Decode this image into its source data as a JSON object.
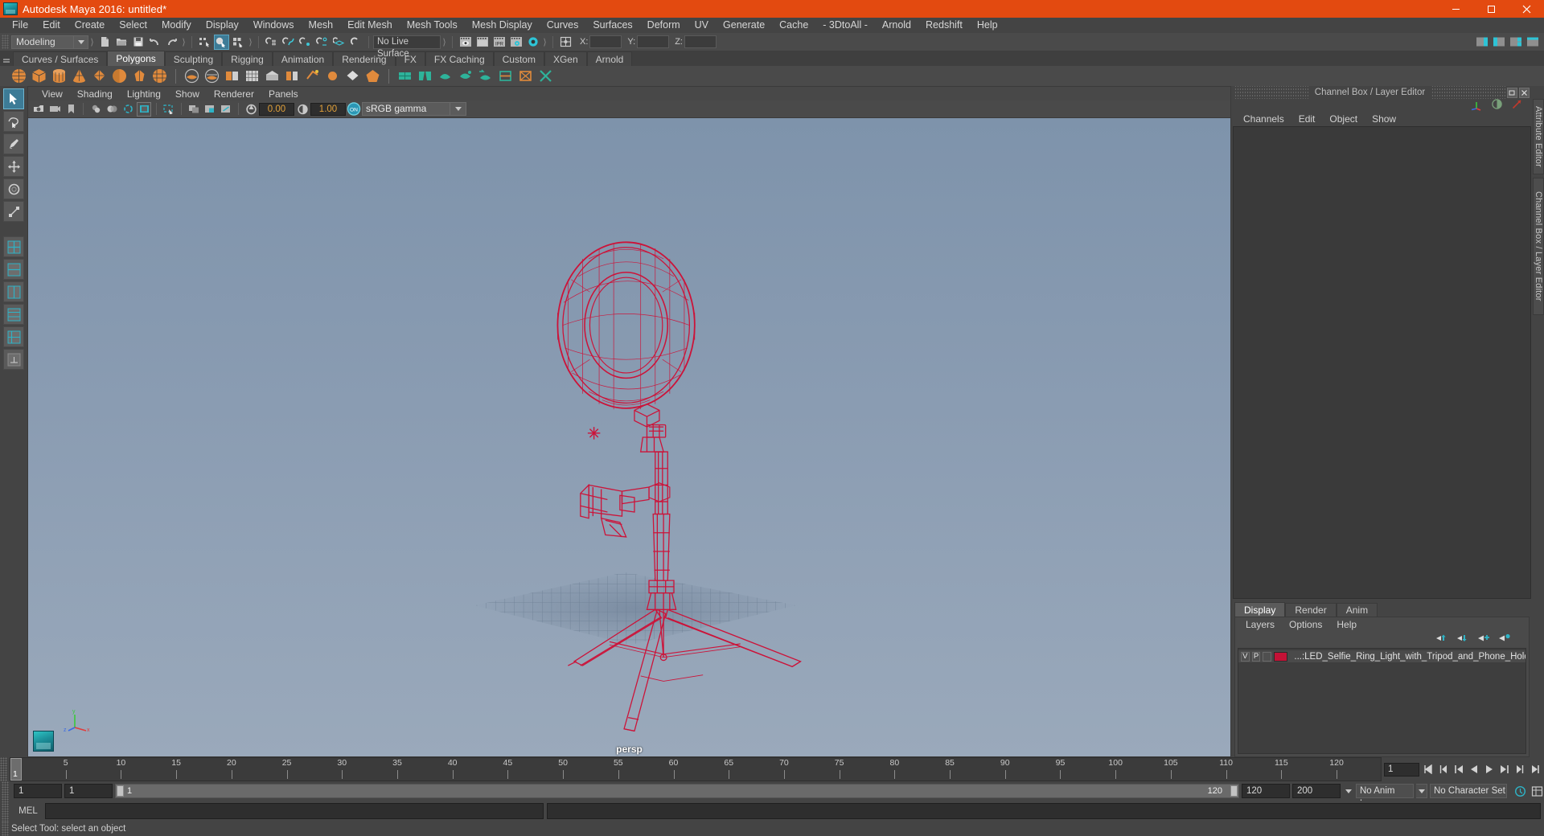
{
  "titlebar": {
    "title": "Autodesk Maya 2016: untitled*",
    "logo_icon": "maya-logo-icon",
    "minimize_icon": "minimize-icon",
    "maximize_icon": "maximize-icon",
    "close_icon": "close-icon"
  },
  "menubar": {
    "items": [
      {
        "label": "File"
      },
      {
        "label": "Edit"
      },
      {
        "label": "Create"
      },
      {
        "label": "Select"
      },
      {
        "label": "Modify"
      },
      {
        "label": "Display"
      },
      {
        "label": "Windows"
      },
      {
        "label": "Mesh"
      },
      {
        "label": "Edit Mesh"
      },
      {
        "label": "Mesh Tools"
      },
      {
        "label": "Mesh Display"
      },
      {
        "label": "Curves"
      },
      {
        "label": "Surfaces"
      },
      {
        "label": "Deform"
      },
      {
        "label": "UV"
      },
      {
        "label": "Generate"
      },
      {
        "label": "Cache"
      },
      {
        "label": "- 3DtoAll -"
      },
      {
        "label": "Arnold"
      },
      {
        "label": "Redshift"
      },
      {
        "label": "Help"
      }
    ]
  },
  "statusbar": {
    "menu_set": "Modeling",
    "menu_set_arrow_icon": "chevron-down-icon",
    "file_icons": [
      "new-scene-icon",
      "open-scene-icon",
      "save-scene-icon",
      "undo-icon",
      "redo-icon"
    ],
    "select_mode_icons": [
      "select-hierarchy-icon",
      "select-object-icon",
      "select-component-icon"
    ],
    "snap_icons": [
      "snap-grid-icon",
      "snap-curve-icon",
      "snap-point-icon",
      "snap-projected-icon",
      "snap-view-plane-icon",
      "make-live-icon"
    ],
    "live_surface": "No Live Surface",
    "render_icons": [
      "render-current-frame-icon",
      "redo-render-icon",
      "ipr-render-icon",
      "render-settings-icon",
      "hypershade-icon"
    ],
    "xyz": {
      "x_label": "X:",
      "y_label": "Y:",
      "z_label": "Z:",
      "x_value": "",
      "y_value": "",
      "z_value": ""
    },
    "right_icons": [
      "show-attribute-editor-icon",
      "show-tool-settings-icon",
      "show-channel-box-icon",
      "sidebar-toggle-icon"
    ]
  },
  "shelf": {
    "tabs": [
      {
        "label": "Curves / Surfaces",
        "active": false
      },
      {
        "label": "Polygons",
        "active": true
      },
      {
        "label": "Sculpting",
        "active": false
      },
      {
        "label": "Rigging",
        "active": false
      },
      {
        "label": "Animation",
        "active": false
      },
      {
        "label": "Rendering",
        "active": false
      },
      {
        "label": "FX",
        "active": false
      },
      {
        "label": "FX Caching",
        "active": false
      },
      {
        "label": "Custom",
        "active": false
      },
      {
        "label": "XGen",
        "active": false
      },
      {
        "label": "Arnold",
        "active": false
      }
    ],
    "icons": [
      "poly-sphere-icon",
      "poly-cube-icon",
      "poly-cylinder-icon",
      "poly-cone-icon",
      "poly-torus-icon",
      "poly-plane-icon",
      "poly-disc-icon",
      "poly-platonic-icon",
      "poly-pyramid-icon",
      "poly-prism-icon",
      "poly-pipe-icon",
      "poly-helix-icon",
      "poly-gear-icon",
      "poly-soccer-ball-icon",
      "poly-super-ellipse-icon",
      "combine-icon",
      "separate-icon",
      "booleans-icon",
      "smooth-icon",
      "extrude-icon",
      "bevel-icon",
      "bridge-icon",
      "append-polygon-icon",
      "multi-cut-icon",
      "target-weld-icon",
      "quad-draw-icon",
      "mirror-icon",
      "sculpt-icon"
    ]
  },
  "toolbox": {
    "tools": [
      {
        "name": "select-tool",
        "selected": true
      },
      {
        "name": "lasso-select-tool",
        "selected": false
      },
      {
        "name": "paint-select-tool",
        "selected": false
      },
      {
        "name": "move-tool",
        "selected": false
      },
      {
        "name": "rotate-tool",
        "selected": false
      },
      {
        "name": "scale-tool",
        "selected": false
      },
      {
        "name": "four-view-layout-icon",
        "selected": false
      },
      {
        "name": "persp-outliner-layout-icon",
        "selected": false
      },
      {
        "name": "persp-graph-layout-icon",
        "selected": false
      },
      {
        "name": "persp-hypershade-layout-icon",
        "selected": false
      },
      {
        "name": "persp-relationship-layout-icon",
        "selected": false
      },
      {
        "name": "single-perspective-layout-icon",
        "selected": false
      }
    ]
  },
  "viewport": {
    "panel_menu": [
      "View",
      "Shading",
      "Lighting",
      "Show",
      "Renderer",
      "Panels"
    ],
    "camera_label": "persp",
    "toolbar": {
      "exposure_value": "0.00",
      "gamma_value": "1.00",
      "color_management": "sRGB gamma",
      "color_management_arrow_icon": "chevron-down-icon",
      "cm_toggle_label": "ON",
      "icons": [
        "select-camera-icon",
        "camera-attributes-icon",
        "bookmark-icon",
        "image-plane-icon",
        "two-d-pan-zoom-icon",
        "grid-toggle-icon",
        "film-gate-icon",
        "resolution-gate-icon",
        "gate-mask-icon",
        "wireframe-icon",
        "smooth-shade-all-icon",
        "smooth-shade-textured-icon",
        "use-all-lights-icon",
        "shadows-icon",
        "screen-space-ao-icon",
        "motion-blur-icon",
        "multisample-aa-icon",
        "depth-of-field-icon",
        "isolate-select-icon",
        "xray-icon",
        "xray-joints-icon",
        "xray-active-components-icon",
        "exposure-icon",
        "gamma-icon"
      ]
    },
    "axis_gizmo": {
      "x": "x",
      "y": "y",
      "z": "z"
    },
    "model_name": "LED Selfie Ring Light with Tripod and Phone Holder wireframe",
    "model_color": "#cc1339",
    "background_top": "#7e93ab",
    "background_bottom": "#9aa9bb"
  },
  "channel_box": {
    "title": "Channel Box / Layer Editor",
    "undock_icon": "undock-icon",
    "close_icon": "close-icon",
    "header_icons": [
      "axis-tripod-icon",
      "half-circle-icon",
      "red-arrow-icon"
    ],
    "menu": [
      "Channels",
      "Edit",
      "Object",
      "Show"
    ]
  },
  "layer_editor": {
    "tabs": [
      {
        "label": "Display",
        "active": true
      },
      {
        "label": "Render",
        "active": false
      },
      {
        "label": "Anim",
        "active": false
      }
    ],
    "menu": [
      "Layers",
      "Options",
      "Help"
    ],
    "buttons": [
      "move-layer-up-icon",
      "move-layer-down-icon",
      "new-layer-icon",
      "new-layer-from-selected-icon"
    ],
    "layers": [
      {
        "visibility": "V",
        "playback": "P",
        "shading": "",
        "color": "#c41236",
        "name": "...:LED_Selfie_Ring_Light_with_Tripod_and_Phone_Holde"
      }
    ]
  },
  "side_tabs": [
    {
      "label": "Attribute Editor"
    },
    {
      "label": "Channel Box / Layer Editor"
    }
  ],
  "time_slider": {
    "current_frame": "1",
    "ticks": [
      5,
      10,
      15,
      20,
      25,
      30,
      35,
      40,
      45,
      50,
      55,
      60,
      65,
      70,
      75,
      80,
      85,
      90,
      95,
      100,
      105,
      110,
      115,
      120
    ],
    "frame_field": "1",
    "playback_icons": [
      "go-to-start-icon",
      "step-back-frame-icon",
      "step-back-key-icon",
      "play-backwards-icon",
      "play-forwards-icon",
      "step-forward-key-icon",
      "step-forward-frame-icon",
      "go-to-end-icon"
    ]
  },
  "range_slider": {
    "start_field": "1",
    "range_start_field": "1",
    "bar_start_label": "1",
    "bar_end_label": "120",
    "range_end_field": "120",
    "end_field": "200",
    "anim_layer": "No Anim Layer",
    "anim_layer_arrow_icon": "chevron-down-icon",
    "character_set": "No Character Set",
    "auto_key_icon": "auto-keyframe-icon",
    "anim_prefs_icon": "animation-preferences-icon"
  },
  "command_line": {
    "label": "MEL",
    "input_value": "",
    "output_value": ""
  },
  "status_line": {
    "message": "Select Tool: select an object"
  }
}
